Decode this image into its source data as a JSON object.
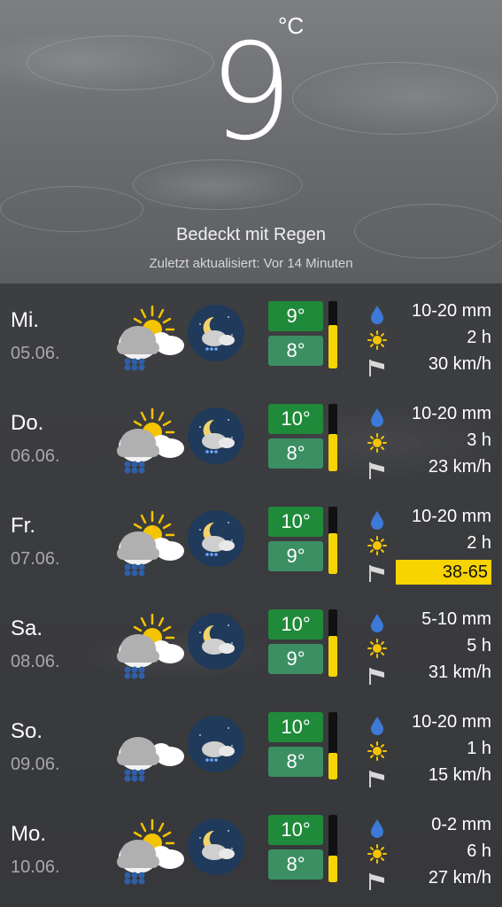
{
  "current": {
    "temperature": "9",
    "unit": "°C",
    "condition": "Bedeckt mit Regen",
    "updated": "Zuletzt aktualisiert: Vor 14 Minuten"
  },
  "forecast": [
    {
      "day": "Mi.",
      "date": "05.06.",
      "max": "9°",
      "min": "8°",
      "rain": "10-20 mm",
      "sun": "2 h",
      "wind": "30 km/h",
      "wind_highlight": false,
      "bar_level": 0.65
    },
    {
      "day": "Do.",
      "date": "06.06.",
      "max": "10°",
      "min": "8°",
      "rain": "10-20 mm",
      "sun": "3 h",
      "wind": "23 km/h",
      "wind_highlight": false,
      "bar_level": 0.55
    },
    {
      "day": "Fr.",
      "date": "07.06.",
      "max": "10°",
      "min": "9°",
      "rain": "10-20 mm",
      "sun": "2 h",
      "wind": "38-65",
      "wind_highlight": true,
      "bar_level": 0.6
    },
    {
      "day": "Sa.",
      "date": "08.06.",
      "max": "10°",
      "min": "9°",
      "rain": "5-10 mm",
      "sun": "5 h",
      "wind": "31 km/h",
      "wind_highlight": false,
      "bar_level": 0.6
    },
    {
      "day": "So.",
      "date": "09.06.",
      "max": "10°",
      "min": "8°",
      "rain": "10-20 mm",
      "sun": "1 h",
      "wind": "15 km/h",
      "wind_highlight": false,
      "bar_level": 0.4
    },
    {
      "day": "Mo.",
      "date": "10.06.",
      "max": "10°",
      "min": "8°",
      "rain": "0-2 mm",
      "sun": "6 h",
      "wind": "27 km/h",
      "wind_highlight": false,
      "bar_level": 0.4
    }
  ],
  "icons": {
    "rain": "drop-icon",
    "sunshine": "sun-icon",
    "wind": "wind-flag-icon"
  },
  "colors": {
    "max_bg": "#1f8a3a",
    "min_bg": "#3b8f63",
    "sun_bar": "#f5d400",
    "gust_highlight": "#f7d300",
    "night_bg": "#1f3a5a"
  }
}
